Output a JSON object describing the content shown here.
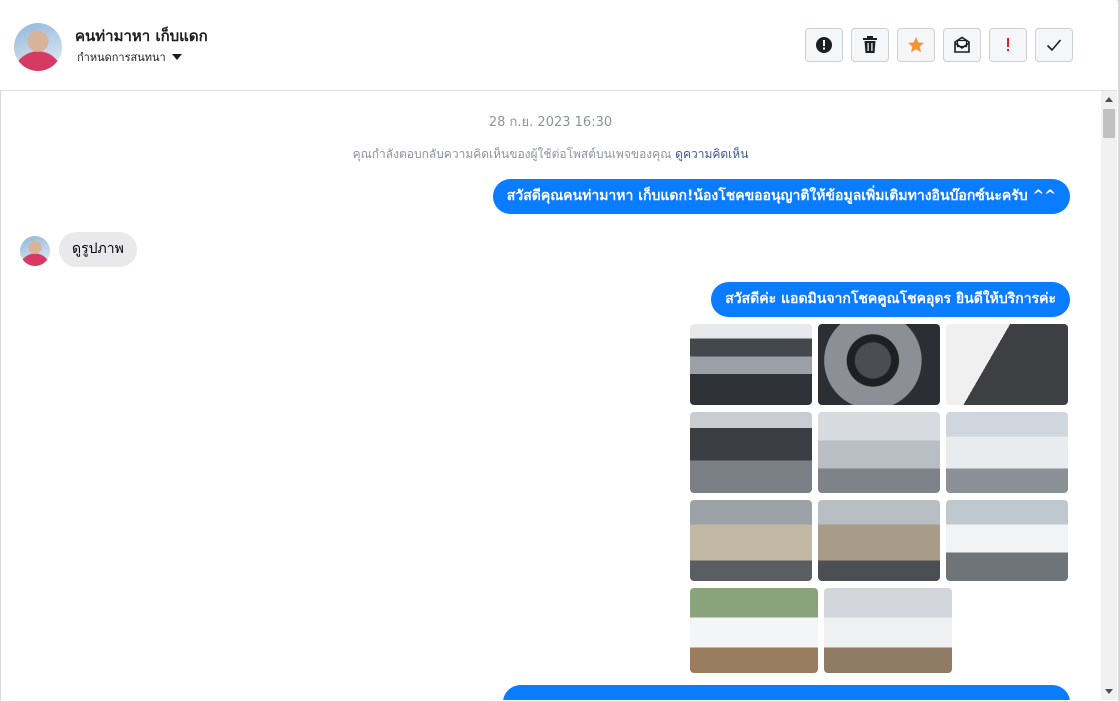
{
  "header": {
    "contact_name": "คนท่ามาหา เก็บแดก",
    "assign_label": "กำหนดการสนทนา",
    "actions": [
      {
        "icon": "alert-circle-icon",
        "label": "!"
      },
      {
        "icon": "trash-icon"
      },
      {
        "icon": "star-icon",
        "color": "#f7923a"
      },
      {
        "icon": "mark-unread-icon"
      },
      {
        "icon": "spam-exclamation-icon",
        "color": "#e02020"
      },
      {
        "icon": "checkmark-icon"
      }
    ]
  },
  "conversation": {
    "timestamp": "28 ก.ย. 2023 16:30",
    "notice_text": "คุณกำลังตอบกลับความคิดเห็นของผู้ใช้ต่อโพสต์บนเพจของคุณ",
    "notice_link": "ดูความคิดเห็น",
    "messages": [
      {
        "direction": "outgoing",
        "text": "สวัสดีคุณคนท่ามาหา เก็บแดก!น้องโชคขออนุญาติให้ข้อมูลเพิ่มเติมทางอินบ๊อกซ์นะครับ ^^"
      },
      {
        "direction": "incoming",
        "text": "ดูรูปภาพ"
      },
      {
        "direction": "outgoing",
        "text": "สวัสดีค่ะ แอดมินจากโชคคูณโชคอุดร ยินดีให้บริการค่ะ"
      }
    ],
    "photo_count": 11
  },
  "colors": {
    "accent": "#0a7cff",
    "incoming_bubble": "#e9e9eb",
    "muted_text": "#8d949e"
  }
}
